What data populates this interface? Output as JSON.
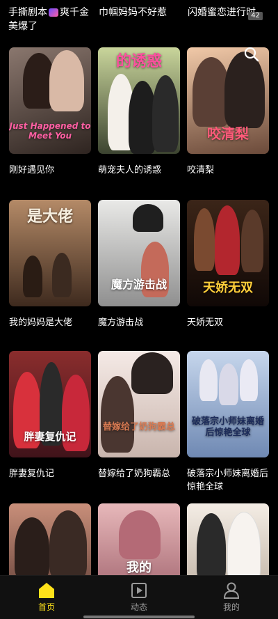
{
  "top_row": {
    "item1_line1": "手撕剧本",
    "item1_line2": "爽千金",
    "item1_line3": "美爆了",
    "item2": "巾帼妈妈不好惹",
    "item3": "闪婚蜜恋进行时",
    "badge_count": "42"
  },
  "grid": {
    "items": [
      {
        "title": "刚好遇见你",
        "poster_text": "Just Happened to Meet You",
        "color_a": "#7b6a63",
        "color_b": "#2e2420"
      },
      {
        "title": "萌宠夫人的诱惑",
        "poster_text": "的诱惑",
        "color_a": "#c9d59b",
        "color_b": "#3c4430"
      },
      {
        "title": "咬清梨",
        "poster_text": "咬清梨",
        "color_a": "#f1c9a8",
        "color_b": "#6b4a3a"
      },
      {
        "title": "我的妈妈是大佬",
        "poster_text": "是大佬",
        "color_a": "#b48a67",
        "color_b": "#3e2a1e"
      },
      {
        "title": "魔方游击战",
        "poster_text": "魔方游击战",
        "color_a": "#e9e9e7",
        "color_b": "#8f8f8f"
      },
      {
        "title": "天娇无双",
        "poster_text": "天娇无双",
        "color_a": "#3b2518",
        "color_b": "#100806"
      },
      {
        "title": "胖妻复仇记",
        "poster_text": "胖妻复仇记",
        "color_a": "#8a2d2d",
        "color_b": "#40131a"
      },
      {
        "title": "替嫁给了奶狗霸总",
        "poster_text": "替嫁给了奶狗霸总",
        "color_a": "#f5eae6",
        "color_b": "#c9b5ad"
      },
      {
        "title": "破落宗小师妹离婚后惊艳全球",
        "poster_text": "破落宗小师妹离婚后惊艳全球",
        "color_a": "#c6d6ec",
        "color_b": "#6f89b3"
      },
      {
        "title": "",
        "poster_text": "",
        "color_a": "#c98f7a",
        "color_b": "#5a3a33"
      },
      {
        "title": "",
        "poster_text": "我的",
        "color_a": "#e7b8ba",
        "color_b": "#9a5b66"
      },
      {
        "title": "",
        "poster_text": "",
        "color_a": "#f4ede5",
        "color_b": "#b7a99a"
      }
    ]
  },
  "bottom_nav": {
    "home": "首页",
    "feed": "动态",
    "me": "我的"
  },
  "colors": {
    "accent": "#ffe21a",
    "inactive": "#9a9a9a",
    "background": "#000000"
  }
}
